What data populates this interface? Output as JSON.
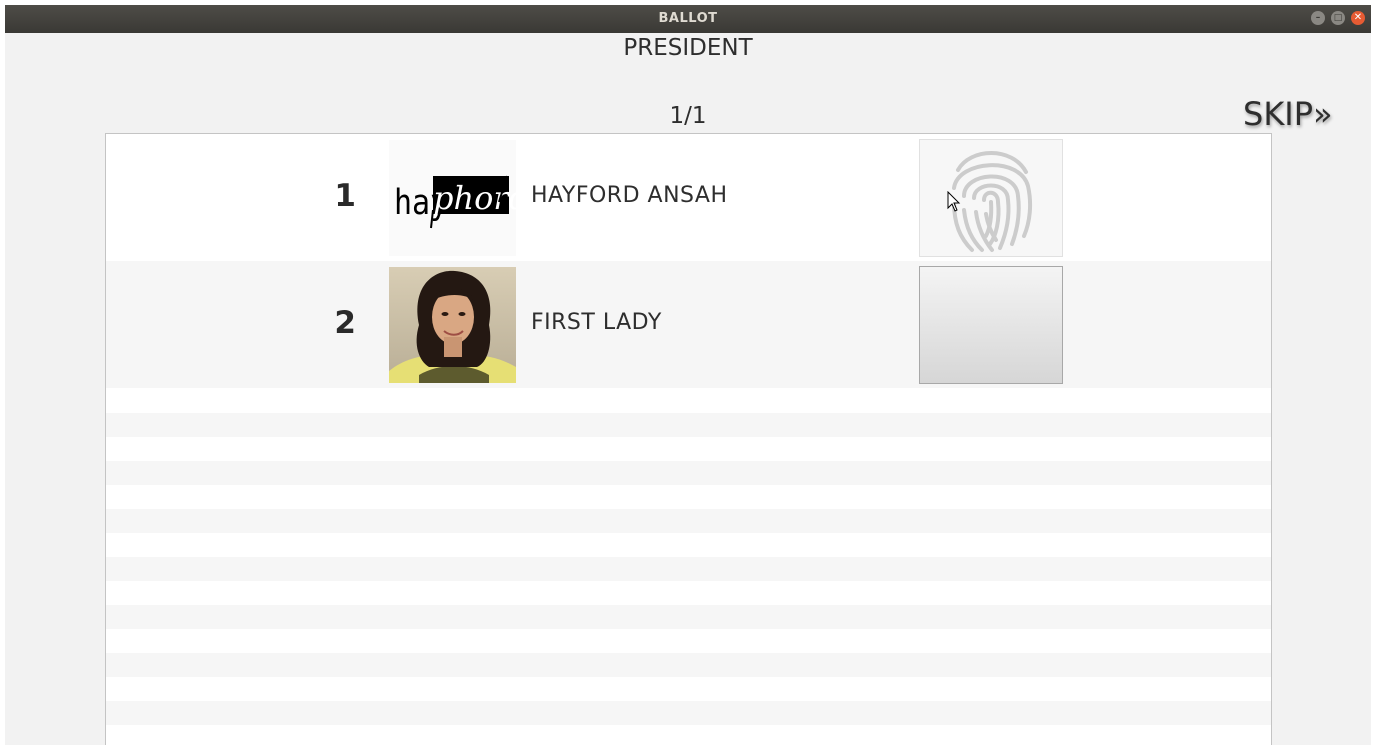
{
  "window": {
    "title": "BALLOT",
    "buttons": [
      "minimize",
      "maximize",
      "close"
    ]
  },
  "ballot": {
    "position": "PRESIDENT",
    "page": "1/1",
    "skip_label": "SKIP»"
  },
  "candidates": [
    {
      "number": "1",
      "name": "HAYFORD ANSAH",
      "photo": "hayphord logo",
      "vote_state": "fingerprint"
    },
    {
      "number": "2",
      "name": "FIRST LADY",
      "photo": "portrait photo",
      "vote_state": "empty"
    }
  ],
  "colors": {
    "titlebar": "#3c3b37",
    "close_button": "#e65b33",
    "background": "#f2f2f2",
    "row_alt": "#f6f6f6"
  }
}
